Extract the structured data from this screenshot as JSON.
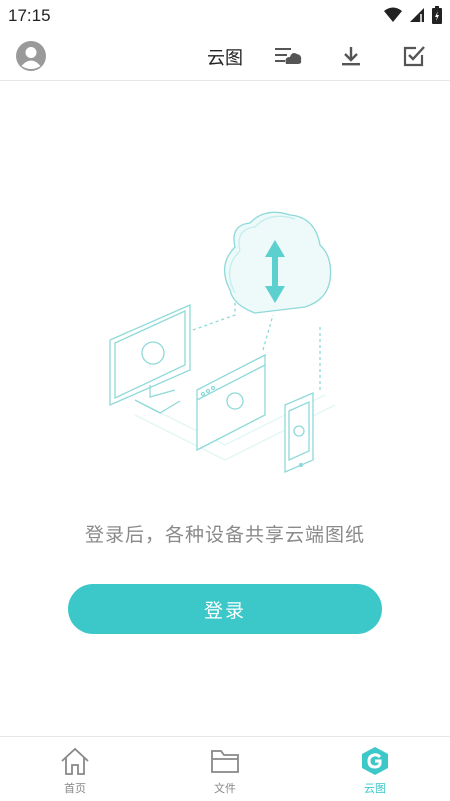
{
  "status_bar": {
    "time": "17:15"
  },
  "app_bar": {
    "title": "云图"
  },
  "main": {
    "hint": "登录后，各种设备共享云端图纸",
    "login_label": "登录"
  },
  "bottom_nav": {
    "items": [
      {
        "label": "首页",
        "icon": "home-icon",
        "active": false
      },
      {
        "label": "文件",
        "icon": "folder-icon",
        "active": false
      },
      {
        "label": "云图",
        "icon": "cloud-g-icon",
        "active": true
      }
    ]
  },
  "colors": {
    "accent": "#3cc8c8",
    "muted_text": "#8a8a8a",
    "illustration": "#8fd9d9"
  }
}
